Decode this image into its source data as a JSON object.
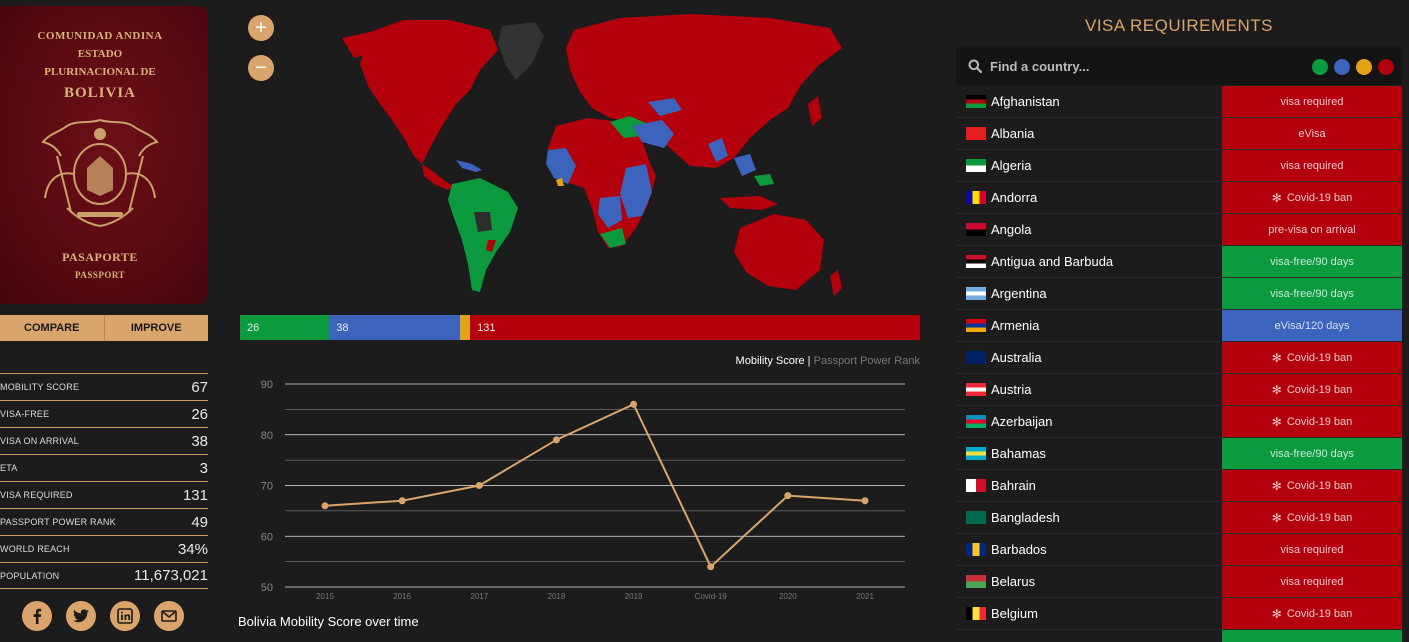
{
  "passport": {
    "line1": "COMUNIDAD ANDINA",
    "line2": "ESTADO",
    "line3": "PLURINACIONAL DE",
    "line4": "BOLIVIA",
    "line5": "PASAPORTE",
    "line6": "PASSPORT"
  },
  "buttons": {
    "compare": "COMPARE",
    "improve": "IMPROVE"
  },
  "stats": [
    {
      "label": "MOBILITY SCORE",
      "value": "67"
    },
    {
      "label": "VISA-FREE",
      "value": "26"
    },
    {
      "label": "VISA ON ARRIVAL",
      "value": "38"
    },
    {
      "label": "ETA",
      "value": "3"
    },
    {
      "label": "VISA REQUIRED",
      "value": "131"
    },
    {
      "label": "PASSPORT POWER RANK",
      "value": "49"
    },
    {
      "label": "WORLD REACH",
      "value": "34%"
    },
    {
      "label": "POPULATION",
      "value": "11,673,021"
    }
  ],
  "zoom": {
    "in": "+",
    "out": "−"
  },
  "bar": [
    {
      "label": "26",
      "value": 26,
      "color": "#0b9a3e"
    },
    {
      "label": "38",
      "value": 38,
      "color": "#3c64bd"
    },
    {
      "label": "",
      "value": 3,
      "color": "#e4a317"
    },
    {
      "label": "131",
      "value": 131,
      "color": "#b4000c"
    }
  ],
  "chart_legend": {
    "active": "Mobility Score",
    "separator": " | ",
    "inactive": "Passport Power Rank"
  },
  "chart_title": "Bolivia Mobility Score over time",
  "chart_data": {
    "type": "line",
    "categories": [
      "2015",
      "2016",
      "2017",
      "2018",
      "2019",
      "Covid-19",
      "2020",
      "2021"
    ],
    "values": [
      66,
      67,
      70,
      79,
      86,
      54,
      68,
      67
    ],
    "yticks": [
      "90",
      "80",
      "70",
      "60",
      "50"
    ],
    "ylim": [
      50,
      90
    ],
    "grid": true,
    "color": "#d9a56c"
  },
  "visa": {
    "title": "VISA REQUIREMENTS",
    "search_placeholder": "Find a country...",
    "filters": [
      "#0b9a3e",
      "#3c64bd",
      "#e4a317",
      "#b4000c"
    ],
    "countries": [
      {
        "name": "Afghanistan",
        "status": "visa required",
        "kind": "red",
        "covid": false
      },
      {
        "name": "Albania",
        "status": "eVisa",
        "kind": "red",
        "covid": false
      },
      {
        "name": "Algeria",
        "status": "visa required",
        "kind": "red",
        "covid": false
      },
      {
        "name": "Andorra",
        "status": "Covid-19 ban",
        "kind": "red",
        "covid": true
      },
      {
        "name": "Angola",
        "status": "pre-visa on arrival",
        "kind": "red",
        "covid": false
      },
      {
        "name": "Antigua and Barbuda",
        "status": "visa-free/90 days",
        "kind": "green",
        "covid": false
      },
      {
        "name": "Argentina",
        "status": "visa-free/90 days",
        "kind": "green",
        "covid": false
      },
      {
        "name": "Armenia",
        "status": "eVisa/120 days",
        "kind": "blue",
        "covid": false
      },
      {
        "name": "Australia",
        "status": "Covid-19 ban",
        "kind": "red",
        "covid": true
      },
      {
        "name": "Austria",
        "status": "Covid-19 ban",
        "kind": "red",
        "covid": true
      },
      {
        "name": "Azerbaijan",
        "status": "Covid-19 ban",
        "kind": "red",
        "covid": true
      },
      {
        "name": "Bahamas",
        "status": "visa-free/90 days",
        "kind": "green",
        "covid": false
      },
      {
        "name": "Bahrain",
        "status": "Covid-19 ban",
        "kind": "red",
        "covid": true
      },
      {
        "name": "Bangladesh",
        "status": "Covid-19 ban",
        "kind": "red",
        "covid": true
      },
      {
        "name": "Barbados",
        "status": "visa required",
        "kind": "red",
        "covid": false
      },
      {
        "name": "Belarus",
        "status": "visa required",
        "kind": "red",
        "covid": false
      },
      {
        "name": "Belgium",
        "status": "Covid-19 ban",
        "kind": "red",
        "covid": true
      }
    ]
  }
}
